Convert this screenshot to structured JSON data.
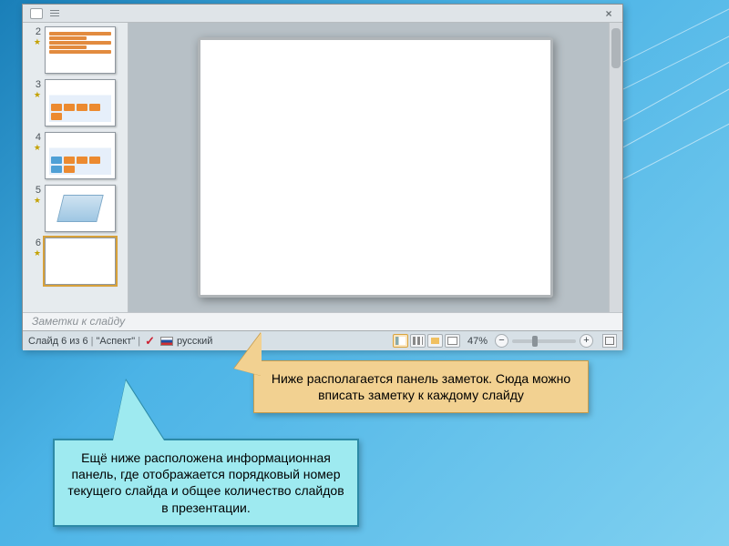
{
  "thumbnails": [
    {
      "n": "2"
    },
    {
      "n": "3"
    },
    {
      "n": "4"
    },
    {
      "n": "5"
    },
    {
      "n": "6"
    }
  ],
  "notes_placeholder": "Заметки к слайду",
  "status": {
    "slide_indicator": "Слайд 6 из 6",
    "theme": "\"Аспект\"",
    "language": "русский",
    "zoom": "47%"
  },
  "callouts": {
    "notes": "Ниже располагается панель заметок. Сюда можно вписать заметку к каждому слайду",
    "statusbar": "Ещё ниже расположена информационная панель, где отображается порядковый номер текущего слайда и общее количество слайдов в презентации."
  }
}
